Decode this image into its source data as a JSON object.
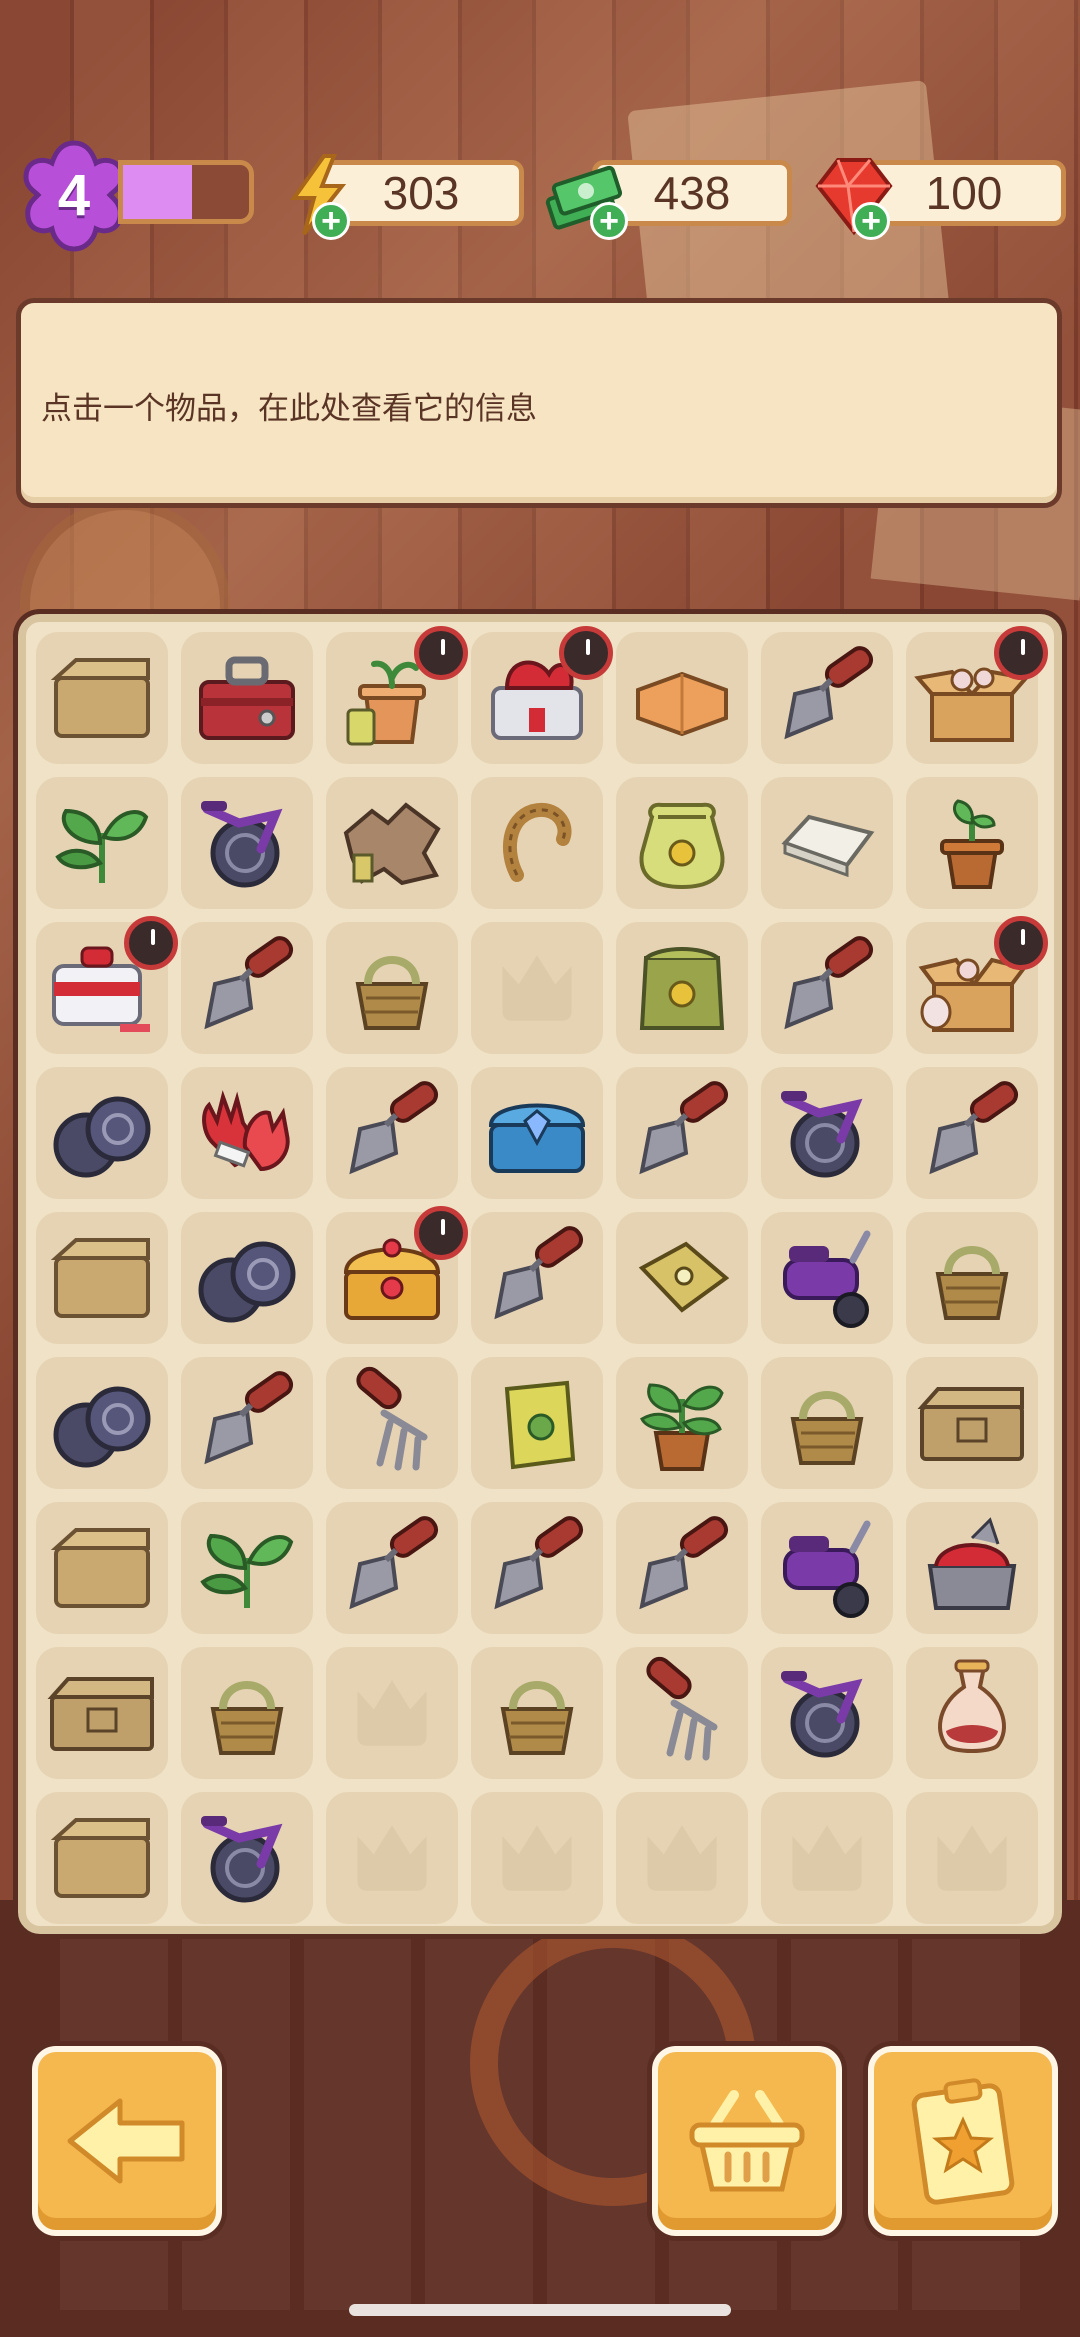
{
  "level": {
    "value": "4",
    "progress": 0.55
  },
  "resources": {
    "energy": {
      "value": "303",
      "icon": "lightning-icon"
    },
    "cash": {
      "value": "438",
      "icon": "cash-stack-icon"
    },
    "gems": {
      "value": "100",
      "icon": "ruby-gem-icon"
    }
  },
  "info_panel": {
    "text": "点击一个物品，在此处查看它的信息"
  },
  "board": {
    "rows": [
      [
        "box",
        "toolbox",
        "plant-pot-sprout",
        "red-toolbox",
        "folded-cloth",
        "trowel",
        "open-box"
      ],
      [
        "leaves",
        "bicycle",
        "torn-paper",
        "rope",
        "seed-bag",
        "soap-bar",
        "potted-sprout"
      ],
      [
        "first-aid-kit",
        "trowel",
        "wicker-basket",
        "empty",
        "green-seed-bag",
        "trowel",
        "open-box-cups"
      ],
      [
        "wheels",
        "gloves",
        "trowel",
        "blue-chest",
        "trowel",
        "bicycle",
        "trowel"
      ],
      [
        "box",
        "wheels",
        "treasure-chest",
        "trowel",
        "seed-packet",
        "scooter",
        "wicker-basket"
      ],
      [
        "wheels",
        "trowel",
        "rake",
        "seed-packet-green",
        "potted-plant",
        "wicker-basket",
        "closed-crate"
      ],
      [
        "box",
        "leaves",
        "trowel",
        "trowel",
        "trowel",
        "scooter",
        "red-bag"
      ],
      [
        "closed-crate",
        "wicker-basket",
        "empty",
        "wicker-basket",
        "rake",
        "bicycle",
        "vase"
      ],
      [
        "box",
        "bicycle",
        "empty",
        "empty",
        "empty",
        "empty",
        "empty"
      ]
    ],
    "timer_items": [
      "0-2",
      "0-3",
      "0-6",
      "2-0",
      "2-6",
      "4-2"
    ]
  },
  "buttons": {
    "back": {
      "icon": "back-arrow-icon"
    },
    "shop": {
      "icon": "basket-icon"
    },
    "tasks": {
      "icon": "star-clipboard-icon"
    }
  }
}
